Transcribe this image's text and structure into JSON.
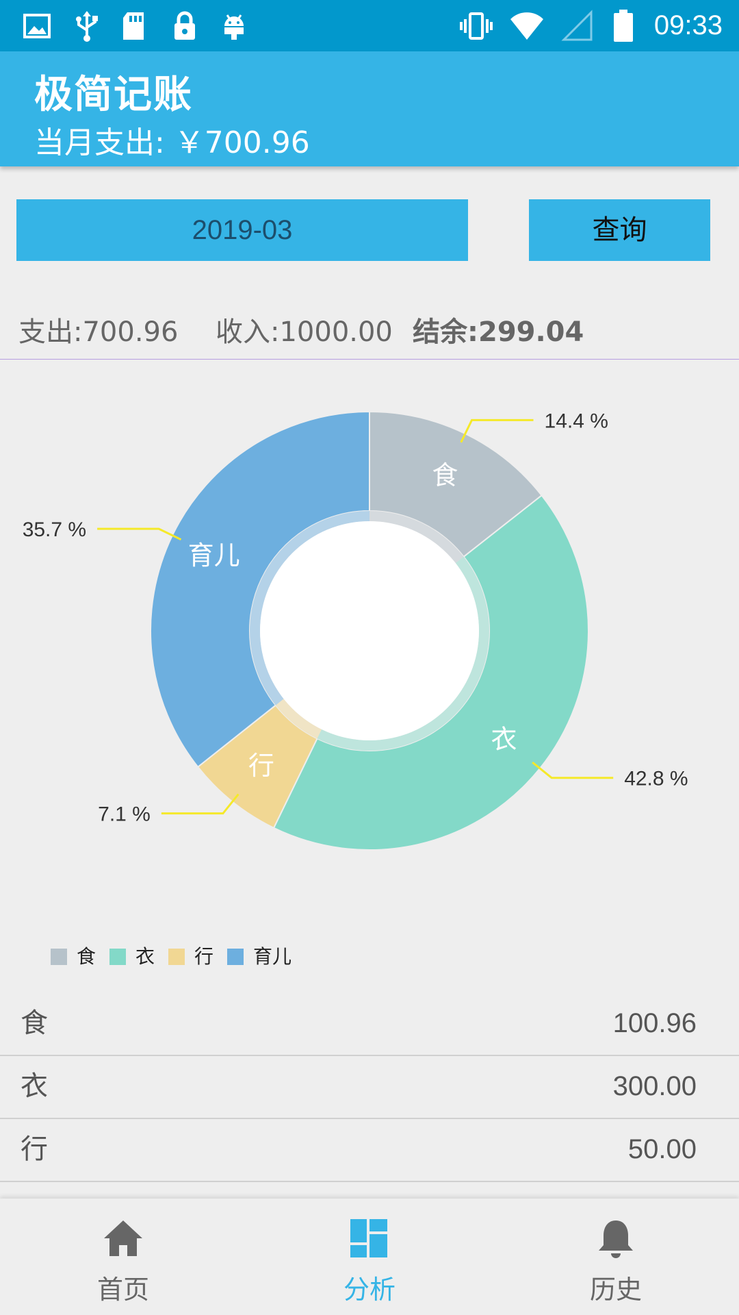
{
  "status_bar": {
    "time": "09:33",
    "left_icons": [
      "image-icon",
      "usb-icon",
      "sd-card-icon",
      "lock-icon",
      "android-icon"
    ],
    "right_icons": [
      "vibrate-icon",
      "wifi-icon",
      "cell-signal-icon",
      "battery-icon"
    ]
  },
  "app_bar": {
    "title": "极简记账",
    "subtitle": "当月支出: ￥700.96"
  },
  "query": {
    "month_value": "2019-03",
    "button_label": "查询"
  },
  "summary": {
    "expense": "支出:700.96",
    "income": "收入:1000.00",
    "balance": "结余:299.04"
  },
  "chart_data": {
    "type": "pie",
    "donut": true,
    "categories": [
      "食",
      "衣",
      "行",
      "育儿"
    ],
    "values": [
      100.96,
      300.0,
      50.0,
      250.0
    ],
    "percent_labels": [
      "14.4 %",
      "42.8 %",
      "7.1 %",
      "35.7 %"
    ],
    "colors": [
      "#b6c2ca",
      "#83d9c8",
      "#f1d793",
      "#6dafdf"
    ],
    "legend": [
      "食",
      "衣",
      "行",
      "育儿"
    ],
    "legend_position": "bottom-left"
  },
  "details": [
    {
      "name": "食",
      "amount": "100.96"
    },
    {
      "name": "衣",
      "amount": "300.00"
    },
    {
      "name": "行",
      "amount": "50.00"
    }
  ],
  "bottom_nav": {
    "items": [
      {
        "label": "首页",
        "icon": "home-icon",
        "active": false
      },
      {
        "label": "分析",
        "icon": "dashboard-icon",
        "active": true
      },
      {
        "label": "历史",
        "icon": "bell-icon",
        "active": false
      }
    ]
  },
  "colors": {
    "status_bar": "#0298cc",
    "primary": "#35b4e6",
    "background": "#eeeeee",
    "leader_line": "#f5e92a"
  }
}
